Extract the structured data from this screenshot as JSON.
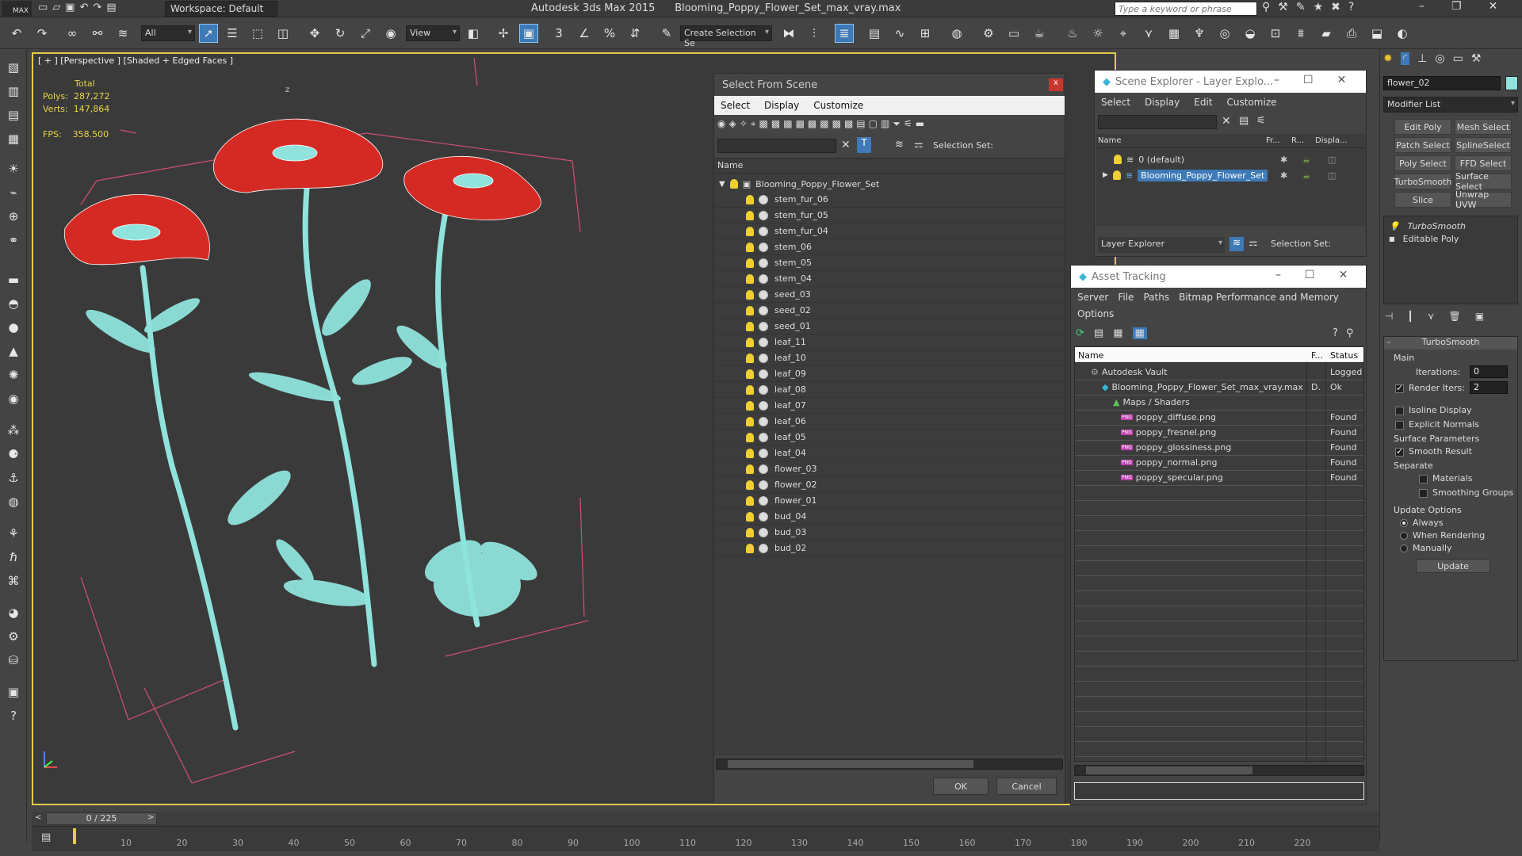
{
  "app": {
    "title": "Autodesk 3ds Max  2015",
    "filename": "Blooming_Poppy_Flower_Set_max_vray.max",
    "logo": "MAX",
    "workspace_label": "Workspace: Default",
    "search_placeholder": "Type a keyword or phrase"
  },
  "toolbar": {
    "selection_filter": "All",
    "ref_coord": "View",
    "create_selection_set": "Create Selection Se",
    "snap_label": "3"
  },
  "viewport": {
    "label": "[ + ] [Perspective ] [Shaded + Edged Faces ]",
    "stats": {
      "total_label": "Total",
      "polys_label": "Polys:",
      "polys_value": "287,272",
      "verts_label": "Verts:",
      "verts_value": "147,864",
      "fps_label": "FPS:",
      "fps_value": "358.500"
    },
    "axis_z": "z"
  },
  "select_from_scene": {
    "title": "Select From Scene",
    "menu": [
      "Select",
      "Display",
      "Customize"
    ],
    "selection_set_label": "Selection Set:",
    "column_name": "Name",
    "root": "Blooming_Poppy_Flower_Set",
    "items": [
      "stem_fur_06",
      "stem_fur_05",
      "stem_fur_04",
      "stem_06",
      "stem_05",
      "stem_04",
      "seed_03",
      "seed_02",
      "seed_01",
      "leaf_11",
      "leaf_10",
      "leaf_09",
      "leaf_08",
      "leaf_07",
      "leaf_06",
      "leaf_05",
      "leaf_04",
      "flower_03",
      "flower_02",
      "flower_01",
      "bud_04",
      "bud_03",
      "bud_02"
    ],
    "ok": "OK",
    "cancel": "Cancel",
    "close": "x"
  },
  "scene_explorer": {
    "title": "Scene Explorer - Layer Explo...",
    "menu": [
      "Select",
      "Display",
      "Edit",
      "Customize"
    ],
    "columns": [
      "Name",
      "Fr...",
      "R...",
      "Displa..."
    ],
    "layers": [
      "0 (default)",
      "Blooming_Poppy_Flower_Set"
    ],
    "footer_dropdown": "Layer Explorer",
    "selection_set_label": "Selection Set:"
  },
  "asset_tracking": {
    "title": "Asset Tracking",
    "menu": [
      "Server",
      "File",
      "Paths",
      "Bitmap Performance and Memory"
    ],
    "menu2": "Options",
    "columns": [
      "Name",
      "F...",
      "Status"
    ],
    "rows": [
      {
        "name": "Autodesk Vault",
        "f": "",
        "status": "Logged"
      },
      {
        "name": "Blooming_Poppy_Flower_Set_max_vray.max",
        "f": "D.",
        "status": "Ok"
      },
      {
        "name": "Maps / Shaders",
        "f": "",
        "status": ""
      },
      {
        "name": "poppy_diffuse.png",
        "f": "",
        "status": "Found"
      },
      {
        "name": "poppy_fresnel.png",
        "f": "",
        "status": "Found"
      },
      {
        "name": "poppy_glossiness.png",
        "f": "",
        "status": "Found"
      },
      {
        "name": "poppy_normal.png",
        "f": "",
        "status": "Found"
      },
      {
        "name": "poppy_specular.png",
        "f": "",
        "status": "Found"
      }
    ],
    "png_badge": "PNG"
  },
  "command_panel": {
    "object_name": "flower_02",
    "modifier_list": "Modifier List",
    "buttons": [
      "Edit Poly",
      "Mesh Select",
      "Patch Select",
      "SplineSelect",
      "Poly Select",
      "FFD Select",
      "TurboSmooth",
      "Surface Select",
      "Slice",
      "Unwrap UVW"
    ],
    "stack": [
      "TurboSmooth",
      "Editable Poly"
    ],
    "rollout_title": "TurboSmooth",
    "main_label": "Main",
    "iterations_label": "Iterations:",
    "iterations_value": "0",
    "render_iters_label": "Render Iters:",
    "render_iters_value": "2",
    "isoline": "Isoline Display",
    "explicit": "Explicit Normals",
    "surface_params": "Surface Parameters",
    "smooth_result": "Smooth Result",
    "separate": "Separate",
    "materials": "Materials",
    "smoothing_groups": "Smoothing Groups",
    "update_options": "Update Options",
    "always": "Always",
    "when_rendering": "When Rendering",
    "manually": "Manually",
    "update": "Update"
  },
  "timeline": {
    "frame_label": "0 / 225",
    "ticks": [
      "10",
      "20",
      "30",
      "40",
      "50",
      "60",
      "70",
      "80",
      "90",
      "100",
      "110",
      "120",
      "130",
      "140",
      "150",
      "160",
      "170",
      "180",
      "190",
      "200",
      "210",
      "220"
    ]
  },
  "colors": {
    "accent": "#3d7ab7",
    "viewport_border": "#e6c84a",
    "petal": "#d42a23",
    "stem": "#8fe3dc",
    "bbox": "#d2506e"
  }
}
